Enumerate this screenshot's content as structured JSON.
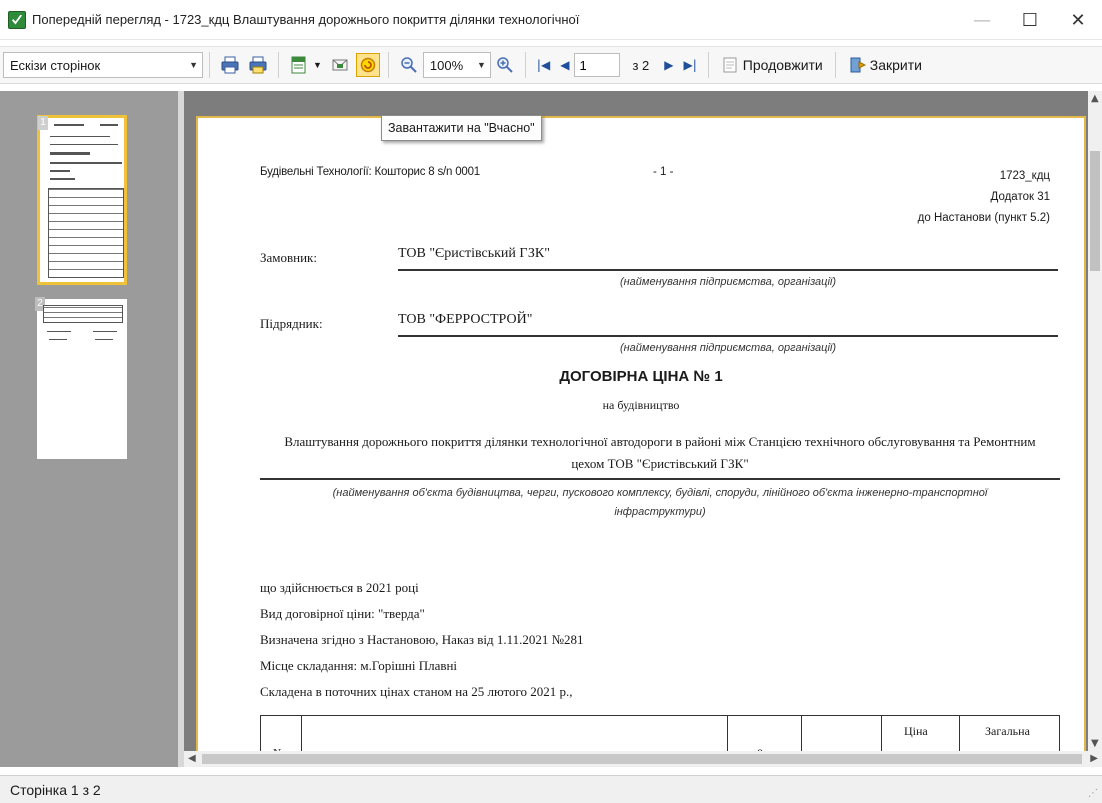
{
  "window": {
    "title": "Попередній перегляд - 1723_кдц Влаштування дорожнього покриття ділянки технологічної",
    "controls": {
      "minimize": "—",
      "maximize": "☐",
      "close": "✕"
    }
  },
  "toolbar": {
    "view_select": "Ескізи сторінок",
    "zoom": "100%",
    "page_current": "1",
    "page_of": "з 2",
    "continue_label": "Продовжити",
    "close_label": "Закрити",
    "tooltip": "Завантажити на \"Вчасно\""
  },
  "thumbnails": {
    "items": [
      {
        "number": "1",
        "selected": true
      },
      {
        "number": "2",
        "selected": false
      }
    ]
  },
  "document": {
    "header_left": "Будівельні Технології: Кошторис 8   s/n 0001",
    "header_center": "- 1 -",
    "header_right_1": "1723_кдц",
    "header_right_2": "Додаток 31",
    "header_right_3": "до Настанови (пункт 5.2)",
    "customer_label": "Замовник:",
    "customer_value": "ТОВ \"Єристівський ГЗК\"",
    "org_caption": "(найменування підприємства, організації)",
    "contractor_label": "Підрядник:",
    "contractor_value": "ТОВ \"ФЕРРОСТРОЙ\"",
    "title": "ДОГОВІРНА ЦІНА № 1",
    "subtitle": "на будівництво",
    "object_line1": "Влаштування дорожнього покриття ділянки технологічної автодороги в районі між Станцією технічного обслуговування та Ремонтним",
    "object_line2": "цехом ТОВ \"Єристівський ГЗК\"",
    "object_caption_1": "(найменування об'єкта будівництва, черги, пускового комплексу, будівлі, споруди, лінійного об'єкта інженерно-транспортної",
    "object_caption_2": "інфраструктури)",
    "para1": "що здійснюється в 2021 році",
    "para2": "Вид договірної ціни: \"тверда\"",
    "para3": "Визначена згідно з Настановою, Наказ від 1.11.2021 №281",
    "para4": "Місце складання: м.Горішні Плавні",
    "para5": "Складена  в поточних цінах станом на 25 лютого 2021 р.,",
    "table_col_price": "Ціна",
    "table_col_total": "Загальна",
    "table_col_no": "№",
    "table_col_o": "о"
  },
  "status": {
    "text": "Сторінка 1  з 2"
  },
  "colors": {
    "accent_yellow": "#f0c23a",
    "nav_blue": "#1f4e9c",
    "thumb_pane": "#9b9b9b",
    "preview_bg": "#7d7d7d"
  }
}
